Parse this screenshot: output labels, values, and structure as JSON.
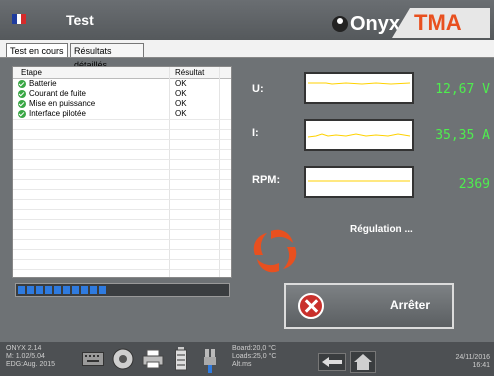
{
  "header": {
    "title": "Test",
    "brand_left": "Onyx",
    "brand_right": "TMA",
    "flag_colors": [
      "#1f3c9e",
      "#ffffff",
      "#d52b2b"
    ]
  },
  "tabs": [
    {
      "label": "Test en cours",
      "active": true
    },
    {
      "label": "Résultats détaillés",
      "active": false
    }
  ],
  "table": {
    "columns": [
      "Etape",
      "Résultat"
    ],
    "rows": [
      {
        "step": "Batterie",
        "result": "OK",
        "icon": "check-icon"
      },
      {
        "step": "Courant de fuite",
        "result": "OK",
        "icon": "check-icon"
      },
      {
        "step": "Mise en puissance",
        "result": "OK",
        "icon": "check-icon"
      },
      {
        "step": "Interface pilotée",
        "result": "OK",
        "icon": "check-icon"
      }
    ]
  },
  "progress": {
    "segments_filled": 10,
    "fraction": 0.45,
    "color": "#2f7be0"
  },
  "measures": [
    {
      "label": "U:",
      "value": "12,67 V"
    },
    {
      "label": "I:",
      "value": "35,35 A"
    },
    {
      "label": "RPM:",
      "value": "2369"
    }
  ],
  "status": "Régulation ...",
  "stop_button": {
    "label": "Arrêter",
    "icon": "stop-icon"
  },
  "footer": {
    "version_lines": [
      "ONYX 2.14",
      "M: 1.02/5.04",
      "EDG:Aug. 2015"
    ],
    "board_lines": [
      "Board:20,0 °C",
      "Loads:25,0 °C",
      "Alt.ms"
    ],
    "datetime_lines": [
      "24/11/2016",
      "16:41"
    ],
    "icons": [
      "keyboard-icon",
      "settings-dial-icon",
      "printer-icon",
      "battery-icon",
      "plug-icon",
      "back-arrow-icon",
      "home-icon"
    ]
  },
  "colors": {
    "accent": "#e8501f",
    "value_green": "#4eee4e",
    "trace_yellow": "#ffd200",
    "stop_red": "#c9302c"
  }
}
